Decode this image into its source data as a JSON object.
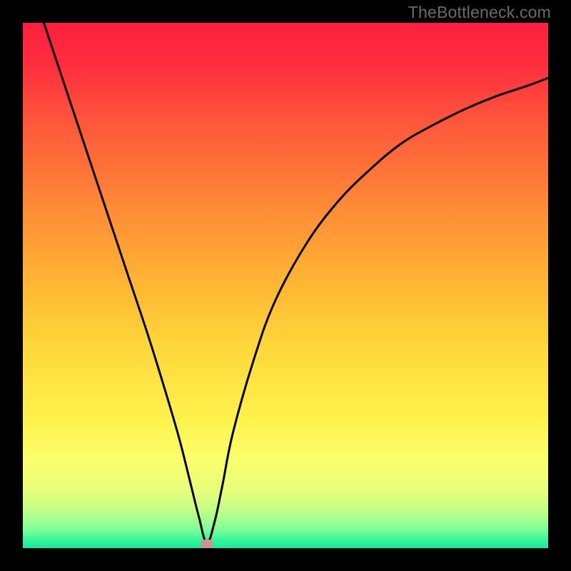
{
  "watermark": "TheBottleneck.com",
  "plot": {
    "inner_x": 32,
    "inner_y": 32,
    "inner_w": 736,
    "inner_h": 736
  },
  "gradient_stops": [
    {
      "offset": 0.0,
      "color": "#ff1f3d"
    },
    {
      "offset": 0.08,
      "color": "#ff2e3e"
    },
    {
      "offset": 0.2,
      "color": "#ff5a3b"
    },
    {
      "offset": 0.35,
      "color": "#ff8a36"
    },
    {
      "offset": 0.5,
      "color": "#ffb733"
    },
    {
      "offset": 0.62,
      "color": "#ffd83a"
    },
    {
      "offset": 0.75,
      "color": "#fff14a"
    },
    {
      "offset": 0.83,
      "color": "#fbff6a"
    },
    {
      "offset": 0.89,
      "color": "#e7ff7a"
    },
    {
      "offset": 0.93,
      "color": "#bfff88"
    },
    {
      "offset": 0.965,
      "color": "#7dff97"
    },
    {
      "offset": 0.985,
      "color": "#35f59a"
    },
    {
      "offset": 1.0,
      "color": "#17e89c"
    }
  ],
  "marker": {
    "x_frac": 0.35,
    "color": "#d58f90"
  },
  "chart_data": {
    "type": "line",
    "title": "",
    "xlabel": "",
    "ylabel": "",
    "xlim": [
      0,
      100
    ],
    "ylim": [
      0,
      100
    ],
    "notes": "V-shaped bottleneck curve on red→green vertical gradient; minimum near x≈35%. Watermark 'TheBottleneck.com' top-right. Small pink marker at curve minimum.",
    "series": [
      {
        "name": "bottleneck-curve",
        "x": [
          4,
          8,
          12,
          16,
          20,
          24,
          28,
          30,
          32,
          33.5,
          35,
          36.5,
          38,
          40,
          44,
          48,
          54,
          60,
          66,
          72,
          78,
          84,
          90,
          96,
          100
        ],
        "values": [
          100,
          88,
          76,
          64,
          52,
          40,
          27,
          20,
          12,
          6,
          1,
          5,
          12,
          22,
          36,
          47,
          58,
          66,
          72,
          77,
          80.5,
          83.5,
          86,
          88,
          89.5
        ]
      }
    ]
  }
}
